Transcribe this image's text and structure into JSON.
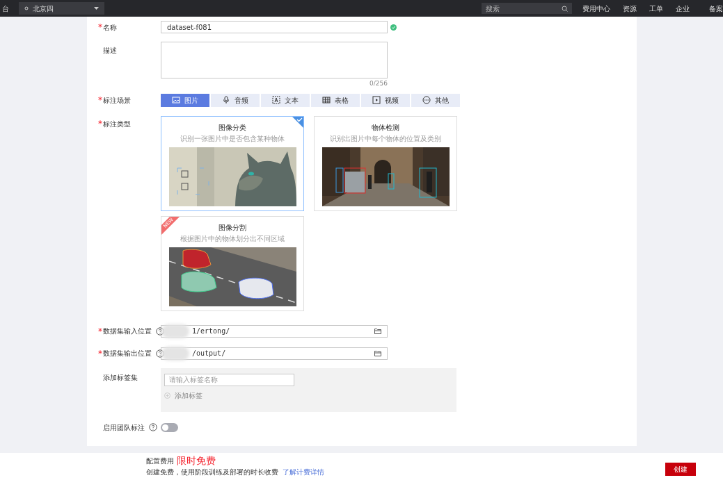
{
  "top_bar": {
    "left_text": "台",
    "region": "北京四",
    "search_placeholder": "搜索",
    "links": [
      "费用中心",
      "资源",
      "工单",
      "企业",
      "备案"
    ]
  },
  "form": {
    "name": {
      "label": "名称",
      "required_mark": "*",
      "value": "dataset-f081",
      "valid": true
    },
    "description": {
      "label": "描述",
      "counter": "0/256"
    },
    "scene": {
      "label": "标注场景",
      "required_mark": "*",
      "tabs": [
        {
          "label": "图片",
          "selected": true
        },
        {
          "label": "音频",
          "selected": false
        },
        {
          "label": "文本",
          "selected": false
        },
        {
          "label": "表格",
          "selected": false
        },
        {
          "label": "视频",
          "selected": false
        },
        {
          "label": "其他",
          "selected": false
        }
      ]
    },
    "type": {
      "label": "标注类型",
      "required_mark": "*",
      "cards": [
        {
          "title": "图像分类",
          "subtitle": "识别一张图片中是否包含某种物体",
          "selected": true
        },
        {
          "title": "物体检测",
          "subtitle": "识别出图片中每个物体的位置及类别",
          "selected": false
        },
        {
          "title": "图像分割",
          "subtitle": "根据图片中的物体划分出不同区域",
          "selected": false,
          "badge": "NEW"
        }
      ]
    },
    "input_location": {
      "label": "数据集输入位置",
      "required_mark": "*",
      "value": "1/ertong/"
    },
    "output_location": {
      "label": "数据集输出位置",
      "required_mark": "*",
      "value": "/output/"
    },
    "tag_set": {
      "label": "添加标签集",
      "placeholder": "请输入标签名称",
      "add_label": "添加标签"
    },
    "team": {
      "label": "启用团队标注",
      "on": false
    }
  },
  "footer": {
    "fee_label": "配置费用",
    "fee_value": "限时免费",
    "note": "创建免费，使用阶段训练及部署的时长收费",
    "link": "了解计费详情",
    "create_button": "创建"
  }
}
